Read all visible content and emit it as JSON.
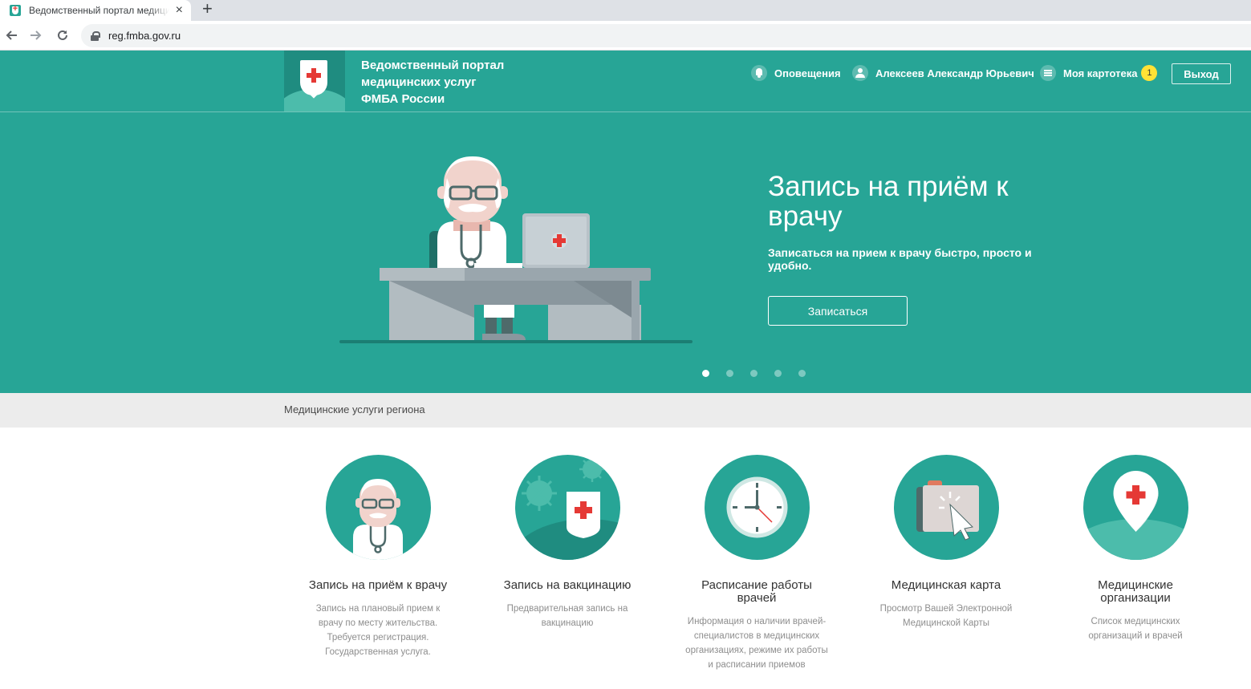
{
  "browser": {
    "tab_title": "Ведомственный портал медицинских услуг",
    "tab_close": "×",
    "new_tab": "+",
    "url": "reg.fmba.gov.ru"
  },
  "header": {
    "title_lines": [
      "Ведомственный портал",
      "медицинских услуг",
      "ФМБА России"
    ],
    "notifications": "Оповещения",
    "user_name": "Алексеев Александр Юрьевич",
    "my_card": "Моя картотека",
    "my_card_count": "1",
    "logout": "Выход"
  },
  "hero": {
    "title": "Запись на приём к врачу",
    "subtitle": "Записаться на прием к врачу быстро, просто и удобно.",
    "button": "Записаться",
    "slides_total": 5,
    "active_slide": 1
  },
  "section": {
    "title": "Медицинские услуги региона"
  },
  "services": [
    {
      "title": "Запись на приём к врачу",
      "description": "Запись на плановый прием к врачу по месту жительства. Требуется регистрация. Государственная услуга.",
      "icon": "doctor-icon"
    },
    {
      "title": "Запись на вакцинацию",
      "description": "Предварительная запись на вакцинацию",
      "icon": "vaccine-shield-icon"
    },
    {
      "title": "Расписание работы врачей",
      "description": "Информация о наличии врачей-специалистов в медицинских организациях, режиме их работы и расписании приемов",
      "icon": "clock-icon"
    },
    {
      "title": "Медицинская карта",
      "description": "Просмотр Вашей Электронной Медицинской Карты",
      "icon": "medical-folder-icon"
    },
    {
      "title": "Медицинские организации",
      "description": "Список медицинских организаций и врачей",
      "icon": "map-pin-icon"
    }
  ],
  "colors": {
    "brand": "#27a596",
    "brand_dark": "#1f8c80",
    "badge": "#ffe236",
    "cross": "#e53935"
  }
}
